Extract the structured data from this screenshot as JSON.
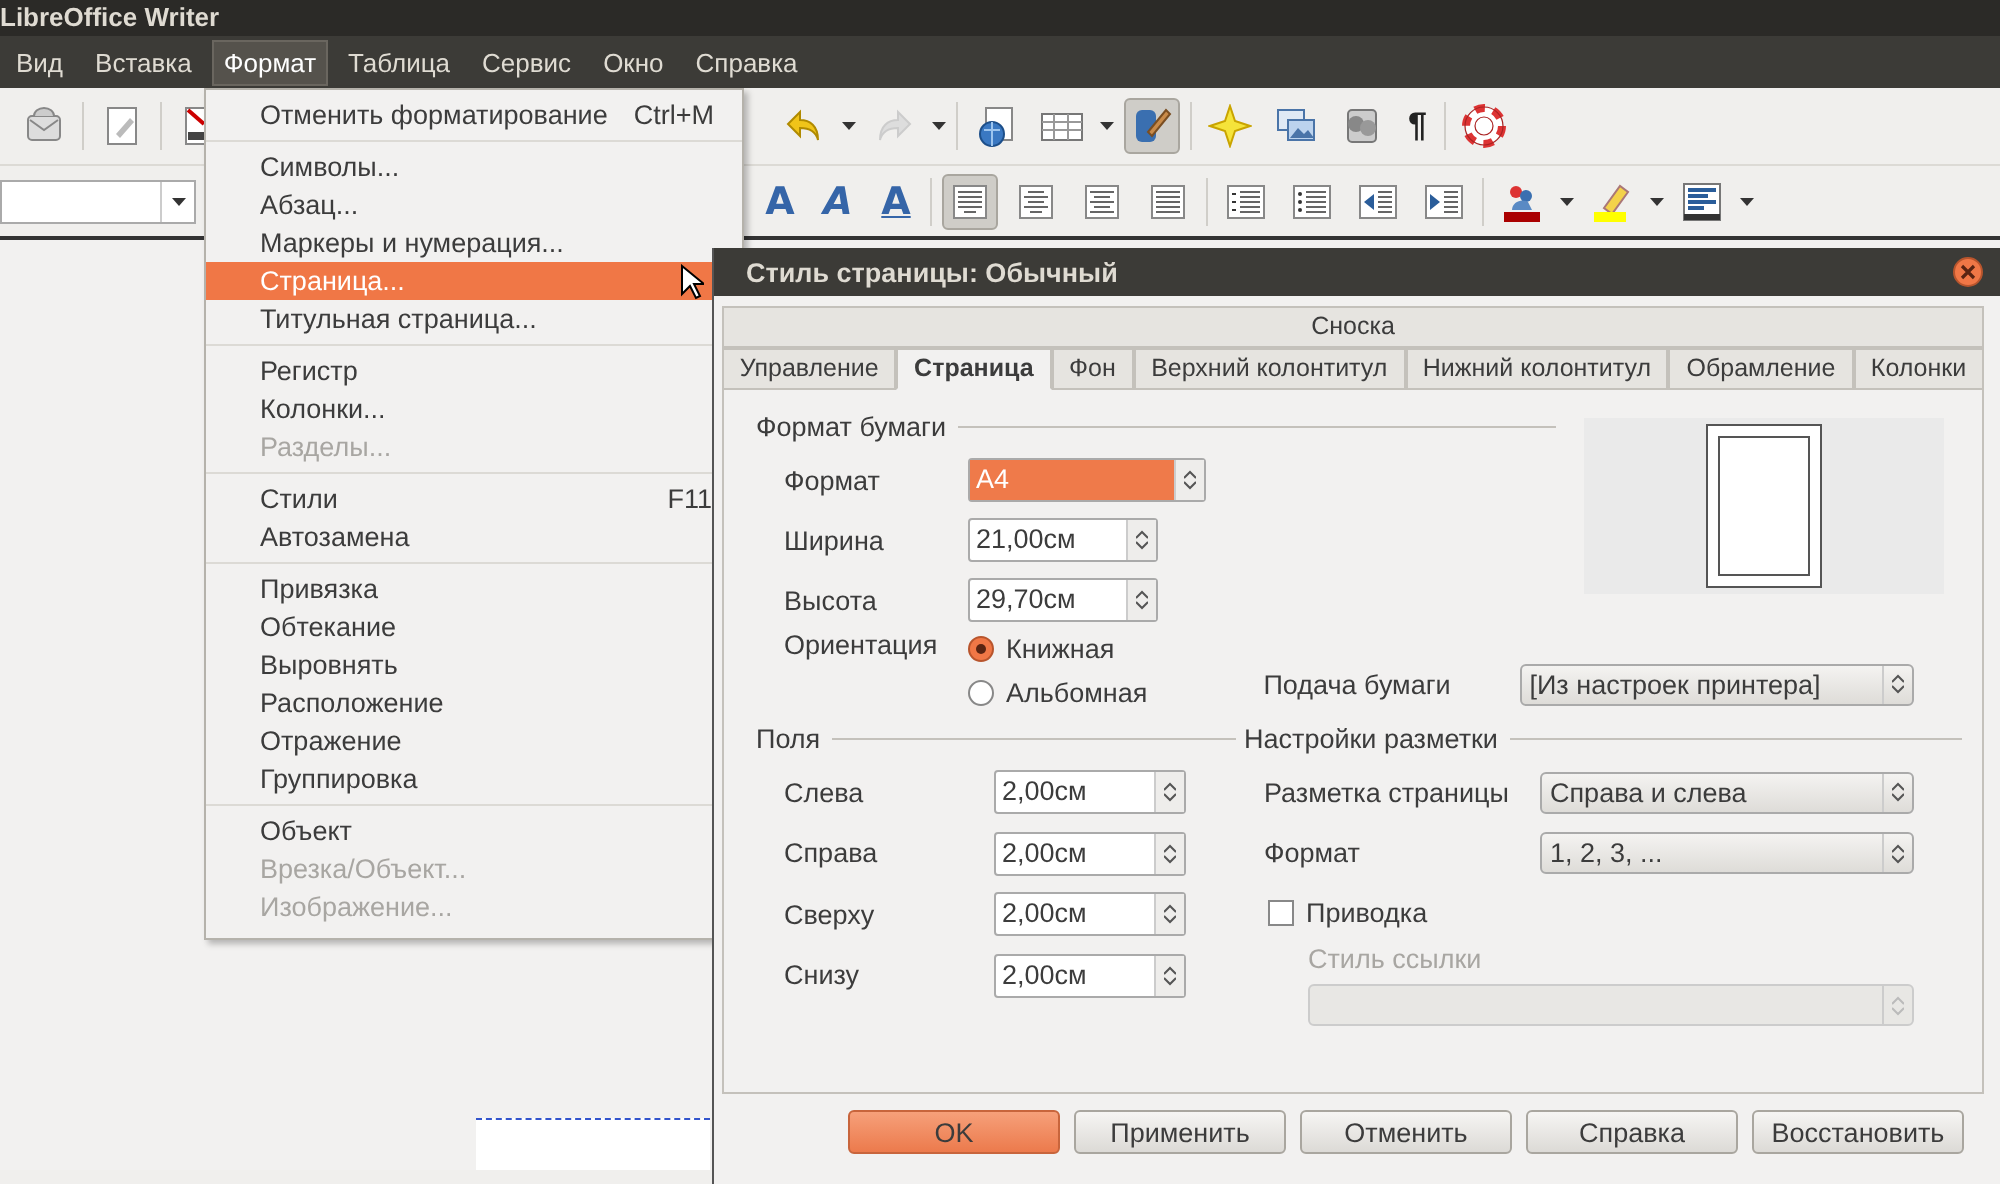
{
  "window": {
    "title": "LibreOffice Writer"
  },
  "menubar": [
    {
      "label": "Вид",
      "selected": false
    },
    {
      "label": "Вставка",
      "selected": false
    },
    {
      "label": "Формат",
      "selected": true
    },
    {
      "label": "Таблица",
      "selected": false
    },
    {
      "label": "Сервис",
      "selected": false
    },
    {
      "label": "Окно",
      "selected": false
    },
    {
      "label": "Справка",
      "selected": false
    }
  ],
  "toolbar_1": {
    "clone_formatting": {
      "on": true
    },
    "pilcrow": "¶"
  },
  "toolbar_2": {
    "text_buttons": [
      {
        "label": "A",
        "kind": "bold"
      },
      {
        "label": "A",
        "kind": "italic"
      },
      {
        "label": "A",
        "kind": "underline"
      }
    ],
    "alignment": [
      {
        "kind": "left",
        "selected": true
      },
      {
        "kind": "center",
        "selected": false
      },
      {
        "kind": "right",
        "selected": false
      },
      {
        "kind": "justify",
        "selected": false
      }
    ]
  },
  "format_menu": {
    "groups": [
      [
        {
          "label": "Отменить форматирование",
          "shortcut": "Ctrl+M",
          "selected": false,
          "disabled": false
        }
      ],
      [
        {
          "label": "Символы...",
          "selected": false,
          "disabled": false
        },
        {
          "label": "Абзац...",
          "selected": false,
          "disabled": false
        },
        {
          "label": "Маркеры и нумерация...",
          "selected": false,
          "disabled": false
        },
        {
          "label": "Страница...",
          "selected": true,
          "disabled": false
        },
        {
          "label": "Титульная страница...",
          "selected": false,
          "disabled": false
        }
      ],
      [
        {
          "label": "Регистр",
          "selected": false,
          "disabled": false
        },
        {
          "label": "Колонки...",
          "selected": false,
          "disabled": false
        },
        {
          "label": "Разделы...",
          "selected": false,
          "disabled": true
        }
      ],
      [
        {
          "label": "Стили",
          "shortcut": "F11",
          "selected": false,
          "disabled": false
        },
        {
          "label": "Автозамена",
          "selected": false,
          "disabled": false
        }
      ],
      [
        {
          "label": "Привязка",
          "selected": false,
          "disabled": false
        },
        {
          "label": "Обтекание",
          "selected": false,
          "disabled": false
        },
        {
          "label": "Выровнять",
          "selected": false,
          "disabled": false
        },
        {
          "label": "Расположение",
          "selected": false,
          "disabled": false
        },
        {
          "label": "Отражение",
          "selected": false,
          "disabled": false
        },
        {
          "label": "Группировка",
          "selected": false,
          "disabled": false
        }
      ],
      [
        {
          "label": "Объект",
          "selected": false,
          "disabled": false
        },
        {
          "label": "Врезка/Объект...",
          "selected": false,
          "disabled": true
        },
        {
          "label": "Изображение...",
          "selected": false,
          "disabled": true
        }
      ]
    ]
  },
  "dialog": {
    "title": "Стиль страницы: Обычный",
    "tabs_row_1": [
      {
        "label": "Сноска",
        "selected": false
      }
    ],
    "tabs": [
      {
        "label": "Управление",
        "selected": false
      },
      {
        "label": "Страница",
        "selected": true
      },
      {
        "label": "Фон",
        "selected": false
      },
      {
        "label": "Верхний колонтитул",
        "selected": false
      },
      {
        "label": "Нижний колонтитул",
        "selected": false
      },
      {
        "label": "Обрамление",
        "selected": false
      },
      {
        "label": "Колонки",
        "selected": false
      }
    ],
    "paper_format": {
      "heading": "Формат бумаги",
      "fields": [
        {
          "label": "Формат",
          "value": "A4",
          "kind": "combo"
        },
        {
          "label": "Ширина",
          "value": "21,00см",
          "kind": "spin"
        },
        {
          "label": "Высота",
          "value": "29,70см",
          "kind": "spin"
        }
      ],
      "orientation": {
        "label": "Ориентация",
        "options": [
          {
            "label": "Книжная",
            "selected": true
          },
          {
            "label": "Альбомная",
            "selected": false
          }
        ]
      },
      "paper_tray": {
        "label": "Подача бумаги",
        "value": "[Из настроек принтера]"
      }
    },
    "margins": {
      "heading": "Поля",
      "fields": [
        {
          "label": "Слева",
          "value": "2,00см"
        },
        {
          "label": "Справа",
          "value": "2,00см"
        },
        {
          "label": "Сверху",
          "value": "2,00см"
        },
        {
          "label": "Снизу",
          "value": "2,00см"
        }
      ]
    },
    "layout": {
      "heading": "Настройки разметки",
      "fields": [
        {
          "label": "Разметка страницы",
          "value": "Справа и слева"
        },
        {
          "label": "Формат",
          "value": "1, 2, 3, ..."
        }
      ],
      "register_true": {
        "label": "Приводка",
        "checked": false
      },
      "reference_style": {
        "label": "Стиль ссылки",
        "disabled": true
      }
    },
    "buttons": [
      {
        "label": "OK",
        "kind": "default"
      },
      {
        "label": "Применить",
        "kind": "normal"
      },
      {
        "label": "Отменить",
        "kind": "normal"
      },
      {
        "label": "Справка",
        "kind": "normal"
      },
      {
        "label": "Восстановить",
        "kind": "normal"
      }
    ]
  }
}
